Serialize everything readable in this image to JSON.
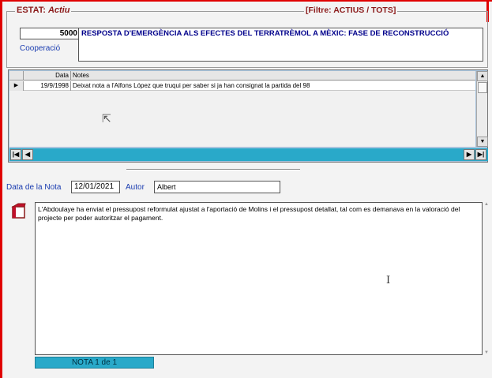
{
  "header": {
    "status_prefix": "ESTAT: ",
    "status_value": "Actiu",
    "filter": "[Filtre: ACTIUS / TOTS]",
    "code": "5000",
    "project_title": "RESPOSTA D'EMERGÈNCIA ALS EFECTES DEL TERRATRÈMOL A MÈXIC: FASE DE RECONSTRUCCIÓ",
    "category": "Cooperació"
  },
  "grid": {
    "columns": [
      "Data",
      "Notes"
    ],
    "rows": [
      {
        "date": "19/9/1998",
        "note": "Deixat nota a l'Alfons López que truqui per saber si ja han consignat la partida del 98"
      }
    ]
  },
  "note": {
    "date_label": "Data de la Nota",
    "date_value": "12/01/2021",
    "author_label": "Autor",
    "author_value": "Albert",
    "body": "L'Abdoulaye ha enviat el pressupost reformulat ajustat a l'aportació de Molins i el pressupost detallat, tal com es demanava en la valoració del projecte per poder autoritzar el pagament.",
    "counter": "NOTA 1 de 1"
  },
  "nav": {
    "first": "|◀",
    "prev": "◀",
    "next": "▶",
    "last": "▶|"
  },
  "icons": {
    "row_selector": "▶",
    "scroll_up": "▲",
    "scroll_down": "▼"
  },
  "colors": {
    "accent_red": "#e00000",
    "title_dark_red": "#8b1a1a",
    "label_blue": "#1a3cb0",
    "nav_teal": "#29a9c9"
  }
}
